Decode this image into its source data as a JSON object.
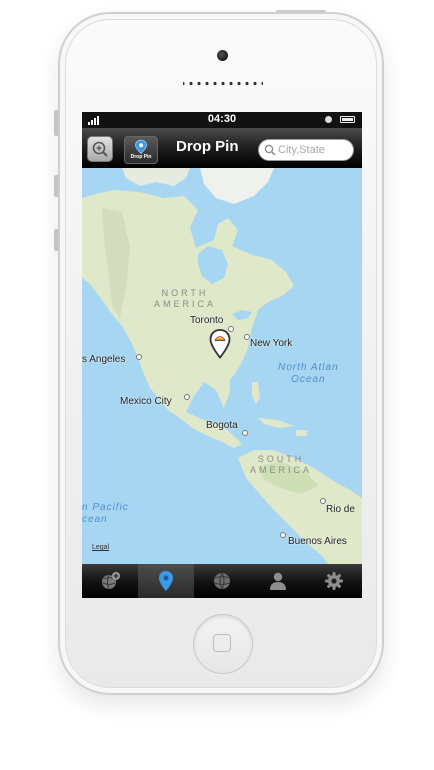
{
  "status_bar": {
    "carrier": "",
    "time": "04:30"
  },
  "nav_bar": {
    "title": "Drop Pin",
    "drop_pin_button_label": "Drop Pin",
    "search_placeholder": "City,State"
  },
  "map": {
    "continents": [
      {
        "key": "north_america",
        "text": "NORTH\nAMERICA"
      },
      {
        "key": "south_america",
        "text": "SOUTH\nAMERICA"
      }
    ],
    "cities": {
      "toronto": "Toronto",
      "new_york": "New York",
      "los_angeles": "s Angeles",
      "mexico_city": "Mexico City",
      "bogota": "Bogota",
      "rio": "Rio de",
      "buenos_aires": "Buenos Aires"
    },
    "oceans": {
      "north_atlantic": "North Atlan\nOcean",
      "pacific": "n Pacific\ncean"
    },
    "legal": "Legal",
    "water_color": "#a7d6f2",
    "land_color": "#dfe8c9"
  },
  "tab_bar": {
    "active_index": 1,
    "tabs": [
      {
        "icon": "globe-plus-icon"
      },
      {
        "icon": "map-pin-icon"
      },
      {
        "icon": "globe-icon"
      },
      {
        "icon": "person-icon"
      },
      {
        "icon": "gear-icon"
      }
    ]
  },
  "colors": {
    "pin_blue": "#3a9ae8",
    "nav_dark": "#1e1e1e"
  }
}
